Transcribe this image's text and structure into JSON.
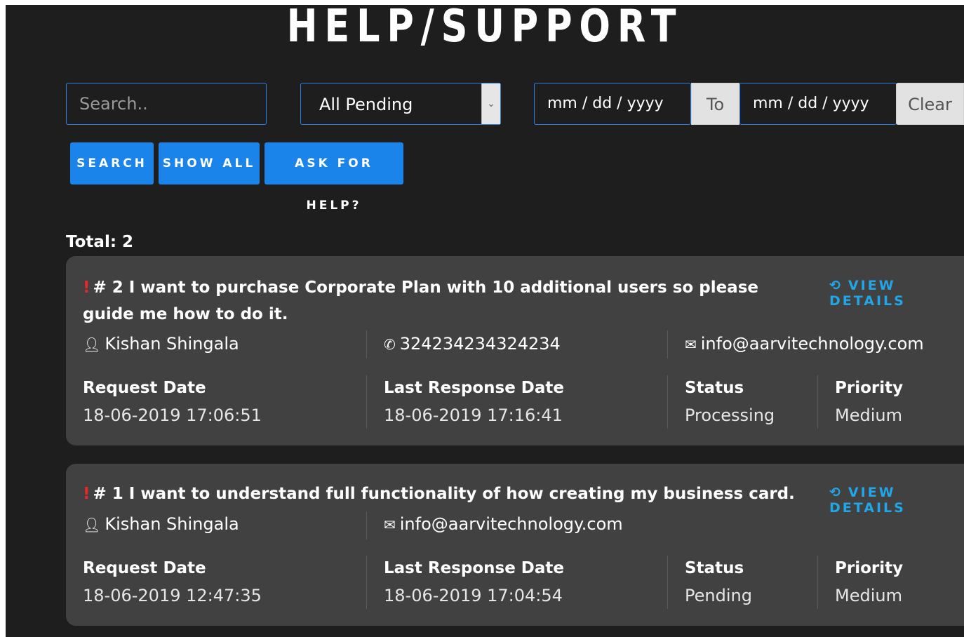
{
  "header": {
    "title": "HELP/SUPPORT"
  },
  "filters": {
    "search_placeholder": "Search..",
    "status_selected": "All Pending",
    "date_from_placeholder": "mm / dd / yyyy",
    "to_label": "To",
    "date_to_placeholder": "mm / dd / yyyy",
    "clear_label": "Clear"
  },
  "actions": {
    "search_label": "SEARCH",
    "show_all_label": "SHOW ALL",
    "ask_help_label": "ASK FOR HELP?"
  },
  "total_label": "Total: 2",
  "tickets": [
    {
      "marker": "!",
      "title": "# 2 I want to purchase Corporate Plan with 10 additional users so please guide me how to do it.",
      "view_details": "VIEW DETAILS",
      "name": "Kishan Shingala",
      "phone": "324234234324234",
      "email": "info@aarvitechnology.com",
      "request_date_label": "Request Date",
      "request_date": "18-06-2019 17:06:51",
      "last_response_label": "Last Response Date",
      "last_response": "18-06-2019 17:16:41",
      "status_label": "Status",
      "status": "Processing",
      "priority_label": "Priority",
      "priority": "Medium"
    },
    {
      "marker": "!",
      "title": "# 1 I want to understand full functionality of how creating my business card.",
      "view_details": "VIEW DETAILS",
      "name": "Kishan Shingala",
      "email": "info@aarvitechnology.com",
      "request_date_label": "Request Date",
      "request_date": "18-06-2019 12:47:35",
      "last_response_label": "Last Response Date",
      "last_response": "18-06-2019 17:04:54",
      "status_label": "Status",
      "status": "Pending",
      "priority_label": "Priority",
      "priority": "Medium"
    }
  ],
  "icons": {
    "user": "user-icon",
    "phone": "phone-icon",
    "email": "envelope-icon",
    "history": "history-icon",
    "exclamation": "exclamation-icon"
  },
  "colors": {
    "background": "#1e1e1e",
    "card": "#414141",
    "primary_button": "#1a84ea",
    "link": "#21a6e8",
    "alert": "#e8262b"
  }
}
